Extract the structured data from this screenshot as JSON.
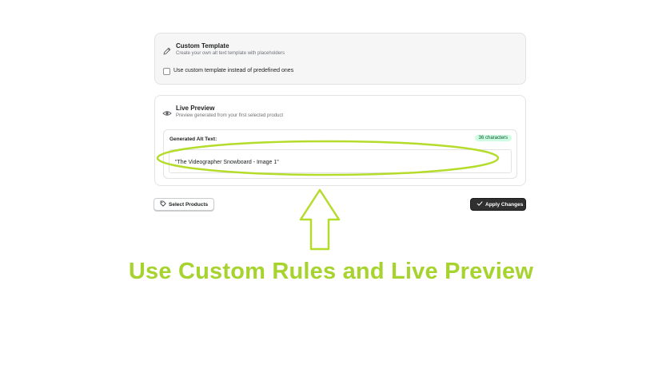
{
  "custom_template": {
    "title": "Custom Template",
    "subtitle": "Create your own alt text template with placeholders",
    "checkbox_label": "Use custom template instead of predefined ones",
    "checkbox_checked": false,
    "icon": "pencil-icon"
  },
  "live_preview": {
    "title": "Live Preview",
    "subtitle": "Preview generated from your first selected product",
    "icon": "eye-icon",
    "generated_label": "Generated Alt Text:",
    "char_badge": "36 characters",
    "alt_text": "\"The Videographer Snowboard - Image 1\""
  },
  "actions": {
    "select_products": "Select Products",
    "select_icon": "tag-icon",
    "apply_changes": "Apply Changes",
    "apply_icon": "check-icon"
  },
  "annotation": {
    "caption": "Use Custom Rules and Live Preview",
    "color": "#a6d32e"
  },
  "colors": {
    "badge_bg": "#cdfee1",
    "primary_button": "#303030",
    "card_border": "#e3e3e3"
  }
}
